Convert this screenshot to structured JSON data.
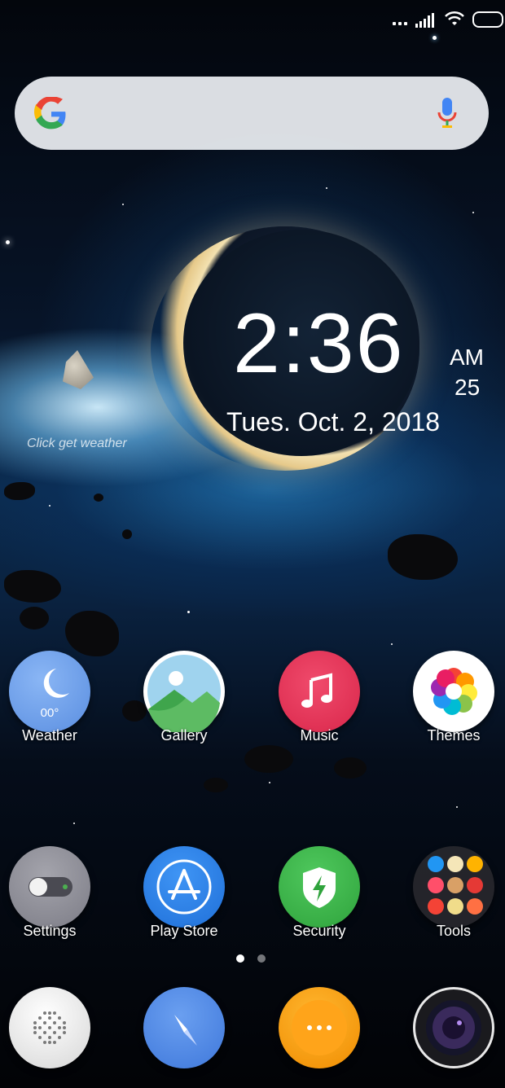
{
  "clock": {
    "time": "2:36",
    "ampm": "AM",
    "seconds": "25",
    "date": "Tues.  Oct. 2,  2018"
  },
  "weather_widget": {
    "prompt": "Click get weather"
  },
  "search": {
    "brand_icon": "google-g-icon",
    "voice_icon": "microphone-icon"
  },
  "statusbar": {
    "icons": [
      "dots-icon",
      "signal-icon",
      "wifi-icon",
      "battery-icon"
    ]
  },
  "apps_row1": [
    {
      "label": "Weather",
      "icon": "weather-moon-icon",
      "temp": "00°",
      "color": "#6a9fe8"
    },
    {
      "label": "Gallery",
      "icon": "gallery-landscape-icon",
      "color": "#7dc8e8"
    },
    {
      "label": "Music",
      "icon": "music-note-icon",
      "color": "#e8365a"
    },
    {
      "label": "Themes",
      "icon": "themes-flower-icon",
      "color": "#ffffff"
    }
  ],
  "apps_row2": [
    {
      "label": "Settings",
      "icon": "settings-toggle-icon",
      "color": "#8c8c94"
    },
    {
      "label": "Play Store",
      "icon": "app-store-icon",
      "color": "#2b7de9"
    },
    {
      "label": "Security",
      "icon": "security-shield-icon",
      "color": "#3cb54a"
    },
    {
      "label": "Tools",
      "icon": "tools-folder-icon",
      "color": "#2a2a2e"
    }
  ],
  "dock": [
    {
      "name": "phone",
      "icon": "phone-speaker-icon"
    },
    {
      "name": "browser",
      "icon": "compass-icon"
    },
    {
      "name": "messages",
      "icon": "messages-dots-icon"
    },
    {
      "name": "camera",
      "icon": "camera-lens-icon"
    }
  ],
  "pager": {
    "pages": 2,
    "active": 1
  }
}
